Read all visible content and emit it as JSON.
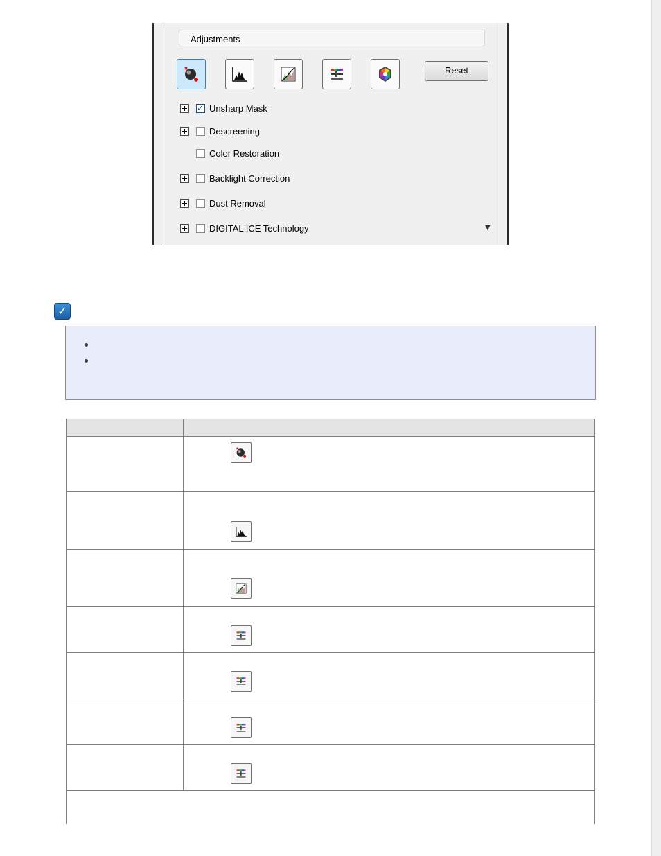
{
  "adjustments": {
    "header": "Adjustments",
    "tool_icons": [
      "auto-exposure-icon",
      "histogram-icon",
      "tone-curve-icon",
      "image-adjustment-icon",
      "color-palette-icon"
    ],
    "reset_label": "Reset",
    "options": [
      {
        "label": "Unsharp Mask",
        "checked": true,
        "expandable": true
      },
      {
        "label": "Descreening",
        "checked": false,
        "expandable": true
      },
      {
        "label": "Color Restoration",
        "checked": false,
        "expandable": false
      },
      {
        "label": "Backlight Correction",
        "checked": false,
        "expandable": true
      },
      {
        "label": "Dust Removal",
        "checked": false,
        "expandable": true
      },
      {
        "label": "DIGITAL ICE Technology",
        "checked": false,
        "expandable": true
      }
    ]
  },
  "note": {
    "icon": "note-check-icon",
    "bullet_count": 2
  },
  "table": {
    "row_icons": [
      "auto-exposure-icon",
      "histogram-icon",
      "tone-curve-icon",
      "image-adjustment-icon",
      "image-adjustment-icon",
      "image-adjustment-icon",
      "image-adjustment-icon"
    ]
  },
  "colors": {
    "note_background": "#e9ecfa",
    "active_tool": "#cde8fb",
    "header_row": "#e4e4e4"
  }
}
